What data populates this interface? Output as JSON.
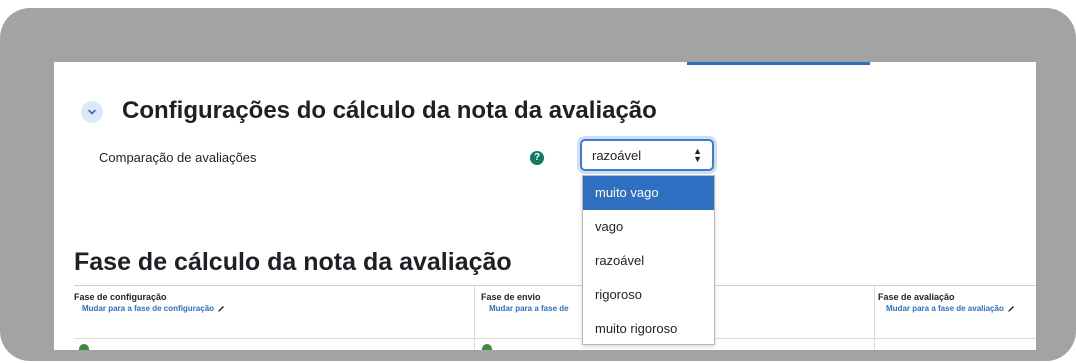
{
  "settings_section": {
    "title": "Configurações do cálculo da nota da avaliação",
    "comparison_label": "Comparação de avaliações",
    "help_icon": "question-circle-icon",
    "select_value": "razoável",
    "options": [
      "muito vago",
      "vago",
      "razoável",
      "rigoroso",
      "muito rigoroso"
    ],
    "highlighted_option": "muito vago"
  },
  "phases": {
    "title": "Fase de cálculo da nota da avaliação",
    "columns": [
      {
        "name": "Fase de configuração",
        "link": "Mudar para a fase de configuração"
      },
      {
        "name": "Fase de envio",
        "link": "Mudar para a fase de"
      },
      {
        "name": "Fase de avaliação",
        "link": "Mudar para a fase de avaliação"
      }
    ]
  },
  "colors": {
    "frame": "#a3a3a3",
    "accent": "#2f6fc2",
    "help": "#0f7b5f"
  }
}
